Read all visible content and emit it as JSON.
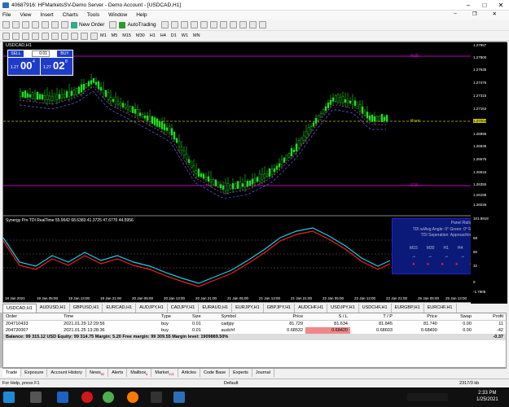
{
  "window": {
    "title": "40687916: HFMarketsSV-Demo Server - Demo Account - [USDCAD,H1]"
  },
  "menu": [
    "File",
    "View",
    "Insert",
    "Charts",
    "Tools",
    "Window",
    "Help"
  ],
  "toolbar": {
    "new_order": "New Order",
    "autotrading": "AutoTrading"
  },
  "timeframes": [
    "M1",
    "M5",
    "M15",
    "M30",
    "H1",
    "H4",
    "D1",
    "W1",
    "MN"
  ],
  "chart": {
    "label": "USDCAD,H1",
    "panel": {
      "sell": "SELL",
      "buy": "BUY",
      "lot": "0.01",
      "bid_small": "1.27",
      "bid_big": "00",
      "bid_pip": "4",
      "ask_small": "1.27",
      "ask_big": "02",
      "ask_pip": "8"
    },
    "levels": {
      "r1": "R1B",
      "pivot": "Pivot",
      "s1": "S1B"
    },
    "indicator_title": "Synergy Pro TDI RealTime 55.9642 68.6383 41.3725 47.6770 44.5956",
    "legend": {
      "panel_ratio": "Panel Ratio: 0.00",
      "angle": "TDI w/Avg Angle: 0° Green: 0° Red: 0°",
      "separation": "TDI Seperation: Approaching [0.0]",
      "tfs": [
        "M15",
        "M30",
        "H1",
        "H4",
        "D1"
      ],
      "arrows": [
        "→",
        "→",
        "→",
        "→",
        "→"
      ],
      "dots": [
        "●",
        "●",
        "●",
        "●",
        "●"
      ]
    },
    "price_scale": [
      "1.27957",
      "1.27800",
      "1.27635",
      "1.27475",
      "1.27315",
      "1.27153",
      "1.26995",
      "1.26835",
      "1.26675",
      "1.26515",
      "1.26355",
      "1.26195",
      "1.26035",
      "1.25875"
    ],
    "current_price": "1.27004",
    "tdi_scale": [
      "101.9919",
      "68",
      "50",
      "32",
      "0",
      "-1.7909"
    ],
    "time_axis": [
      "18 Jan 2021",
      "19 Jan 05:00",
      "19 Jan 13:00",
      "19 Jan 21:00",
      "20 Jan 05:00",
      "20 Jan 13:00",
      "20 Jan 21:00",
      "21 Jan 05:00",
      "21 Jan 13:00",
      "21 Jan 21:00",
      "22 Jan 05:00",
      "22 Jan 13:00",
      "22 Jan 21:00",
      "25 Jan 05:00",
      "25 Jan 13:00"
    ]
  },
  "chart_tabs": [
    "USDCAD,H1",
    "AUDUSD,H1",
    "GBPUSD,H1",
    "EURCAD,H1",
    "AUDJPY,H1",
    "CADJPY,H1",
    "EURAUD,H1",
    "EURJPY,H1",
    "GBPJPY,H1",
    "AUDCHF,H1",
    "USDJPY,H1",
    "USDCHF,H1",
    "EURGBP,H1",
    "EURCHF,H1"
  ],
  "terminal": {
    "headers": [
      "Order",
      "Time",
      "Type",
      "Size",
      "Symbol",
      "Price",
      "S / L",
      "T / P",
      "Price",
      "Swap",
      "Profit"
    ],
    "rows": [
      [
        "204710433",
        "2021.01.29 12:29:56",
        "buy",
        "0.01",
        "cadjpy",
        "81.729",
        "81.634",
        "81.845",
        "81.740",
        "0.00",
        "11"
      ],
      [
        "204720007",
        "2021.01.25 13:28:36",
        "buy",
        "0.01",
        "audchf",
        "0.68532",
        "0.68420",
        "0.68603",
        "0.68490",
        "0.00",
        "-42"
      ]
    ],
    "balance": "Balance: 99 315.12 USD  Equity: 99 314.75  Margin: 5.20  Free margin: 99 309.55  Margin level: 1909889.50%",
    "total": "-0.37"
  },
  "terminal_tabs": [
    "Trade",
    "Exposure",
    "Account History",
    "News",
    "Alerts",
    "Mailbox",
    "Market",
    "Articles",
    "Code Base",
    "Experts",
    "Journal"
  ],
  "terminal_badges": {
    "News": "82",
    "Mailbox": "6",
    "Market": "121"
  },
  "status": {
    "help": "For Help, press F1",
    "profile": "Default",
    "traffic": "2317/3 kb"
  },
  "clock": {
    "time": "2:33 PM",
    "date": "1/25/2021"
  }
}
